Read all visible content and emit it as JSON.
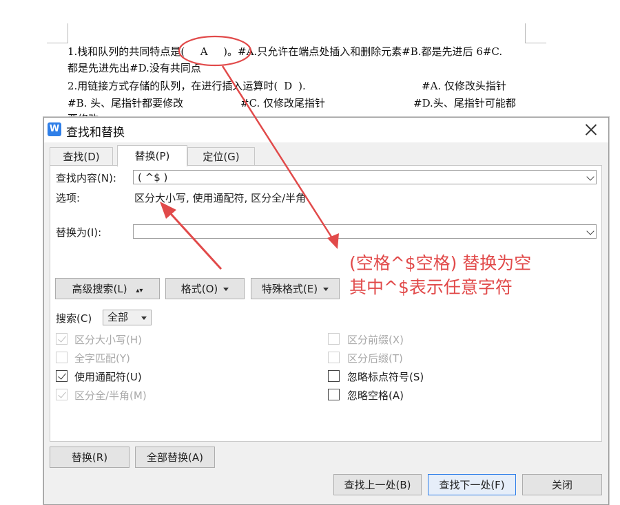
{
  "document": {
    "line1_prefix": "1.栈和队列的共同特点是(",
    "line1_answer": "A",
    "line1_suffix": ")。#A.只允许在端点处插入和删除元素#B.都是先进后 6#C.",
    "line2": "都是先进先出#D.没有共同点",
    "line3_prefix": "2.用链接方式存储的队列，在进行插入运算时(",
    "line3_answer": "D",
    "line3_suffix": ").",
    "line3_option": "#A.  仅修改头指针",
    "line4_a": "#B. 头、尾指针都要修改",
    "line4_b": "#C. 仅修改尾指针",
    "line4_c": "#D.头、尾指针可能都",
    "line5": "要修改"
  },
  "dialog": {
    "app_icon": "W",
    "title": "查找和替换",
    "tabs": [
      {
        "label": "查找(D)",
        "active": false
      },
      {
        "label": "替换(P)",
        "active": true
      },
      {
        "label": "定位(G)",
        "active": false
      }
    ],
    "find_label": "查找内容(N):",
    "find_value": "( ^$ )",
    "options_label": "选项:",
    "options_value": "区分大小写, 使用通配符, 区分全/半角",
    "replace_label": "替换为(I):",
    "replace_value": "",
    "advanced_button": "高级搜索(L)",
    "format_button": "格式(O)",
    "special_button": "特殊格式(E)",
    "search_label": "搜索(C)",
    "search_value": "全部",
    "checkboxes_left": [
      {
        "label": "区分大小写(H)",
        "checked": true,
        "disabled": true
      },
      {
        "label": "全字匹配(Y)",
        "checked": false,
        "disabled": true
      },
      {
        "label": "使用通配符(U)",
        "checked": true,
        "disabled": false
      },
      {
        "label": "区分全/半角(M)",
        "checked": true,
        "disabled": true
      }
    ],
    "checkboxes_right": [
      {
        "label": "区分前缀(X)",
        "checked": false,
        "disabled": true
      },
      {
        "label": "区分后缀(T)",
        "checked": false,
        "disabled": true
      },
      {
        "label": "忽略标点符号(S)",
        "checked": false,
        "disabled": false
      },
      {
        "label": "忽略空格(A)",
        "checked": false,
        "disabled": false
      }
    ],
    "replace_button": "替换(R)",
    "replace_all_button": "全部替换(A)",
    "find_prev_button": "查找上一处(B)",
    "find_next_button": "查找下一处(F)",
    "close_button": "关闭"
  },
  "annotation": {
    "line1": "(空格^$空格) 替换为空",
    "line2": "其中^$表示任意字符",
    "color": "#e14a4a"
  },
  "colors": {
    "accent": "#2f7fe8",
    "annotation": "#e14a4a"
  }
}
